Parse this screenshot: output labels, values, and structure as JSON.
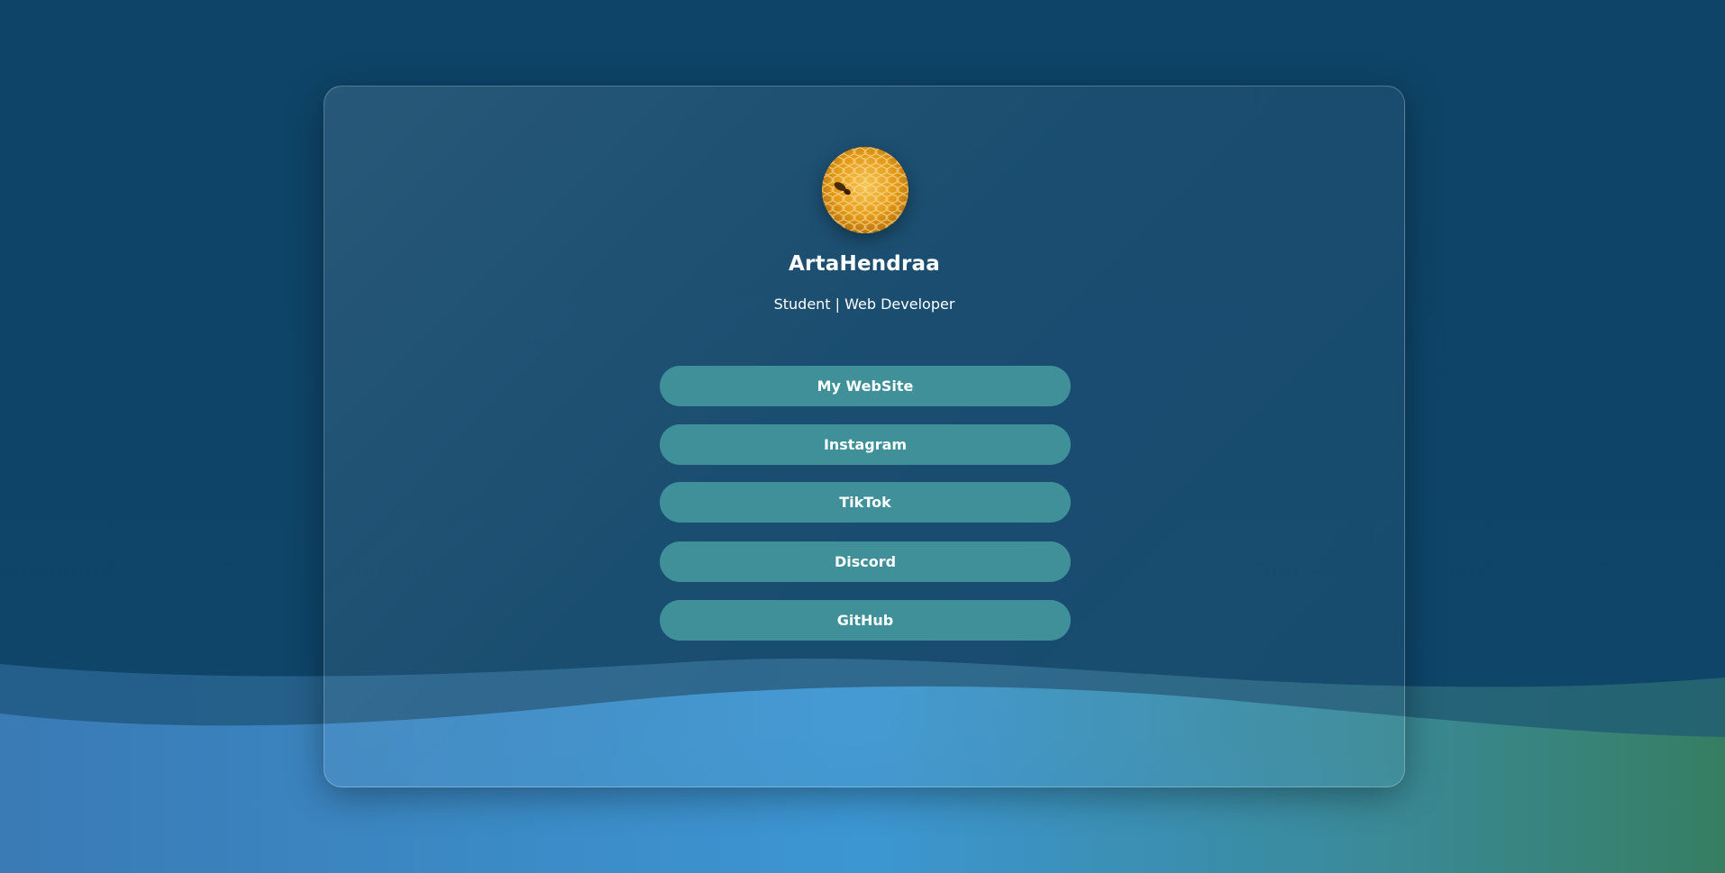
{
  "profile": {
    "name": "ArtaHendraa",
    "tagline": "Student | Web Developer",
    "avatar_icon": "honeycomb-avatar-icon"
  },
  "links": [
    {
      "label": "My WebSite"
    },
    {
      "label": "Instagram"
    },
    {
      "label": "TikTok"
    },
    {
      "label": "Discord"
    },
    {
      "label": "GitHub"
    }
  ],
  "colors": {
    "background_top": "#0e4569",
    "wave_blue": "#3b8fd0",
    "wave_green": "#37846c",
    "button": "#3f9098",
    "text": "#ffffff",
    "avatar": "#e9a21f"
  }
}
